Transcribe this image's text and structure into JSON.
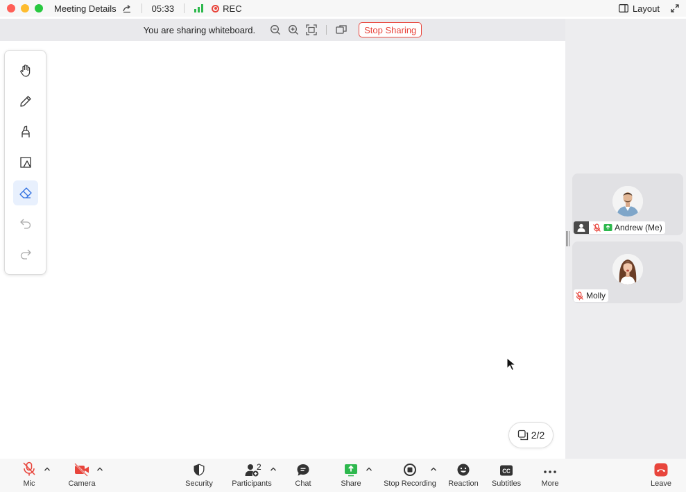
{
  "titlebar": {
    "title": "Meeting Details",
    "time": "05:33",
    "rec_label": "REC",
    "layout_label": "Layout"
  },
  "sharebar": {
    "message": "You are sharing whiteboard.",
    "stop_label": "Stop Sharing"
  },
  "whiteboard": {
    "tools": [
      "hand-icon",
      "pen-icon",
      "highlighter-icon",
      "shapes-icon",
      "eraser-icon",
      "undo-icon",
      "redo-icon"
    ],
    "active_tool": "eraser-icon",
    "page_indicator": "2/2"
  },
  "participants_panel": {
    "tiles": [
      {
        "name": "Andrew (Me)",
        "muted": true,
        "sharing": true,
        "is_me": true
      },
      {
        "name": "Molly",
        "muted": true,
        "sharing": false,
        "is_me": false
      }
    ]
  },
  "bottombar": {
    "mic_label": "Mic",
    "camera_label": "Camera",
    "security_label": "Security",
    "participants_label": "Participants",
    "participants_count": "2",
    "chat_label": "Chat",
    "share_label": "Share",
    "stop_recording_label": "Stop Recording",
    "reaction_label": "Reaction",
    "subtitles_label": "Subtitles",
    "more_label": "More",
    "leave_label": "Leave"
  },
  "colors": {
    "danger": "#e8453c",
    "share_green": "#2db84d",
    "active_tool_bg": "#e8f0fd",
    "active_tool_icon": "#2f6fe0"
  }
}
